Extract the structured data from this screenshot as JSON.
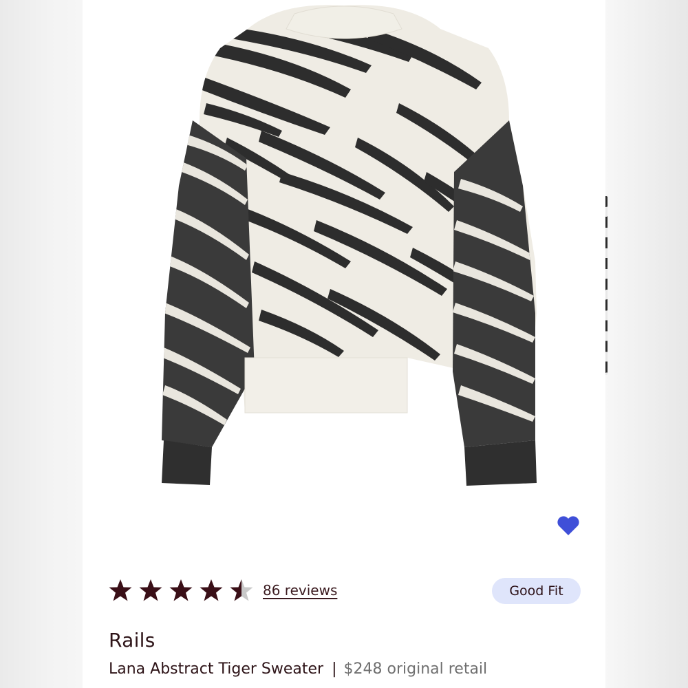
{
  "product": {
    "brand": "Rails",
    "name": "Lana Abstract Tiger Sweater",
    "separator": "|",
    "retail_price": "$248 original retail",
    "image_icon": "tiger-stripe-sweater-image"
  },
  "rating": {
    "value": 4.5,
    "max": 5,
    "reviews_label": "86 reviews",
    "star_color": "#3a0f17",
    "star_empty_color": "#c9c9c9"
  },
  "fit": {
    "label": "Good Fit",
    "color": "#dfe5fb"
  },
  "favorite": {
    "icon": "heart-icon",
    "color": "#3f4fd8"
  }
}
